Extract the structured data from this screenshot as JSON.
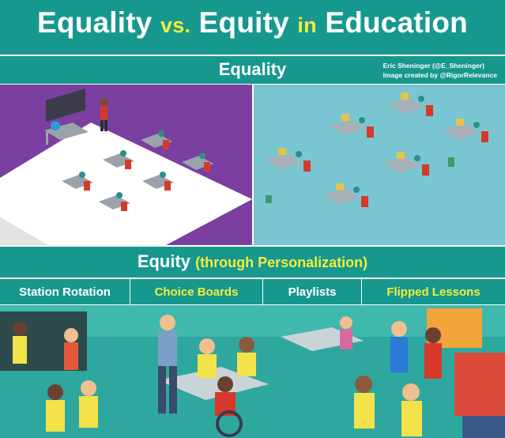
{
  "header": {
    "title_part1": "Equality",
    "title_vs": "vs.",
    "title_part2": "Equity",
    "title_in": "in",
    "title_part3": "Education"
  },
  "equality": {
    "label": "Equality",
    "credit_line1": "Eric Sheninger (@E_Sheninger)",
    "credit_line2": "Image created by @RigorRelevance"
  },
  "equity": {
    "label": "Equity",
    "sub_label": "(through Personalization)",
    "tabs": [
      {
        "label": "Station Rotation",
        "color": "white"
      },
      {
        "label": "Choice Boards",
        "color": "yellow"
      },
      {
        "label": "Playlists",
        "color": "white"
      },
      {
        "label": "Flipped Lessons",
        "color": "yellow"
      }
    ]
  },
  "colors": {
    "teal": "#17988e",
    "yellow": "#f4ec3b",
    "purple": "#7a3fa0",
    "sky": "#79c6d2",
    "floor": "#2ea89e"
  }
}
